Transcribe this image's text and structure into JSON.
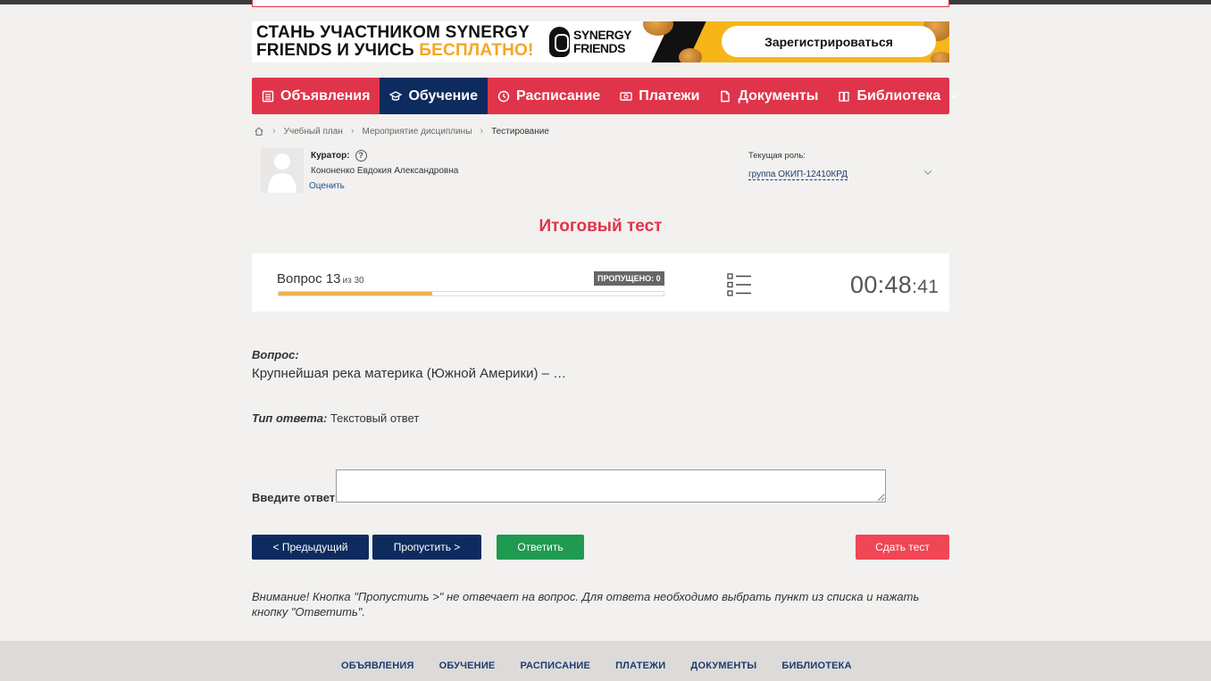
{
  "banner": {
    "line1": "СТАНЬ УЧАСТНИКОМ SYNERGY",
    "line2_prefix": "FRIENDS И УЧИСЬ ",
    "line2_accent": "БЕСПЛАТНО!",
    "logo_line1": "SYNERGY",
    "logo_line2": "FRIENDS",
    "cta": "Зарегистрироваться"
  },
  "nav": {
    "items": [
      {
        "label": "Объявления",
        "icon": "list-icon"
      },
      {
        "label": "Обучение",
        "icon": "graduation-cap-icon"
      },
      {
        "label": "Расписание",
        "icon": "clock-icon"
      },
      {
        "label": "Платежи",
        "icon": "money-icon"
      },
      {
        "label": "Документы",
        "icon": "document-icon"
      },
      {
        "label": "Библиотека",
        "icon": "book-icon"
      }
    ],
    "active": "Обучение"
  },
  "breadcrumb": {
    "items": [
      "Учебный план",
      "Мероприятие дисциплины",
      "Тестирование"
    ]
  },
  "curator": {
    "label": "Куратор:",
    "name": "Кононенко Евдокия Александровна",
    "rate": "Оценить"
  },
  "role": {
    "label": "Текущая роль:",
    "value": "группа ОКИП-12410КРД"
  },
  "page_title": "Итоговый тест",
  "progress": {
    "question_label": "Вопрос 13",
    "of_label": "из 30",
    "current": 13,
    "total": 30,
    "fraction": 0.4,
    "skipped": "ПРОПУЩЕНО: 0",
    "timer_main": "00:48",
    "timer_sec": ":41"
  },
  "question": {
    "title": "Вопрос:",
    "text": "Крупнейшая река материка (Южной Америки) – …",
    "answer_type_label": "Тип ответа:",
    "answer_type_value": " Текстовый ответ",
    "input_label": "Введите ответ:",
    "input_value": ""
  },
  "buttons": {
    "prev": "< Предыдущий",
    "skip": "Пропустить >",
    "answer": "Ответить",
    "submit": "Сдать тест"
  },
  "note": "Внимание! Кнопка \"Пропустить >\" не отвечает на вопрос. Для ответа необходимо выбрать пункт из списка и нажать кнопку \"Ответить\".",
  "footer": {
    "items": [
      "ОБЪЯВЛЕНИЯ",
      "ОБУЧЕНИЕ",
      "РАСПИСАНИЕ",
      "ПЛАТЕЖИ",
      "ДОКУМЕНТЫ",
      "БИБЛИОТЕКА"
    ]
  },
  "colors": {
    "brand_red": "#e0344a",
    "navy": "#0d2b5e",
    "green": "#1f9a50",
    "progress": "#f0b24a"
  }
}
